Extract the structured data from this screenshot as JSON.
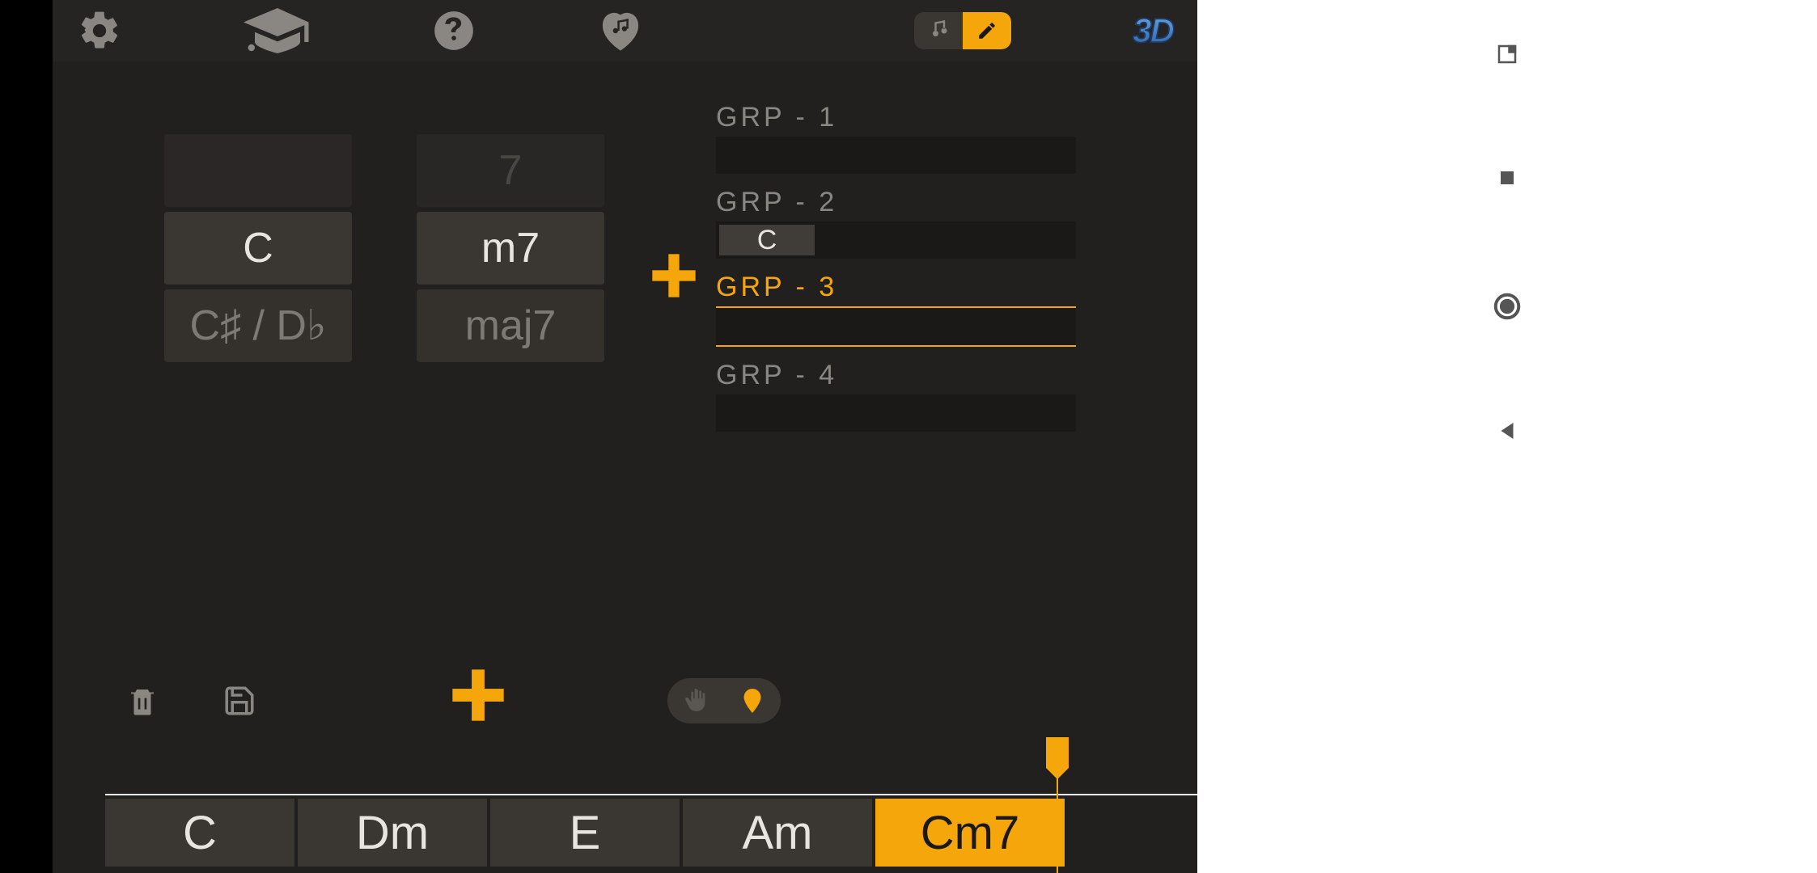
{
  "toolbar": {
    "threeD_label": "3D"
  },
  "wheel": {
    "col1": {
      "cell_dim": "",
      "cell_center": "C",
      "cell_below": "C♯ / D♭"
    },
    "col2": {
      "cell_dim": "7",
      "cell_center": "m7",
      "cell_below": "maj7"
    }
  },
  "groups": [
    {
      "label": "GRP - 1",
      "chords": [],
      "selected": false
    },
    {
      "label": "GRP - 2",
      "chords": [
        "C"
      ],
      "selected": false
    },
    {
      "label": "GRP - 3",
      "chords": [],
      "selected": true
    },
    {
      "label": "GRP - 4",
      "chords": [],
      "selected": false
    }
  ],
  "timeline": {
    "chords": [
      "C",
      "Dm",
      "E",
      "Am",
      "Cm7"
    ],
    "active_index": 4,
    "marker_left_px": 1228
  }
}
